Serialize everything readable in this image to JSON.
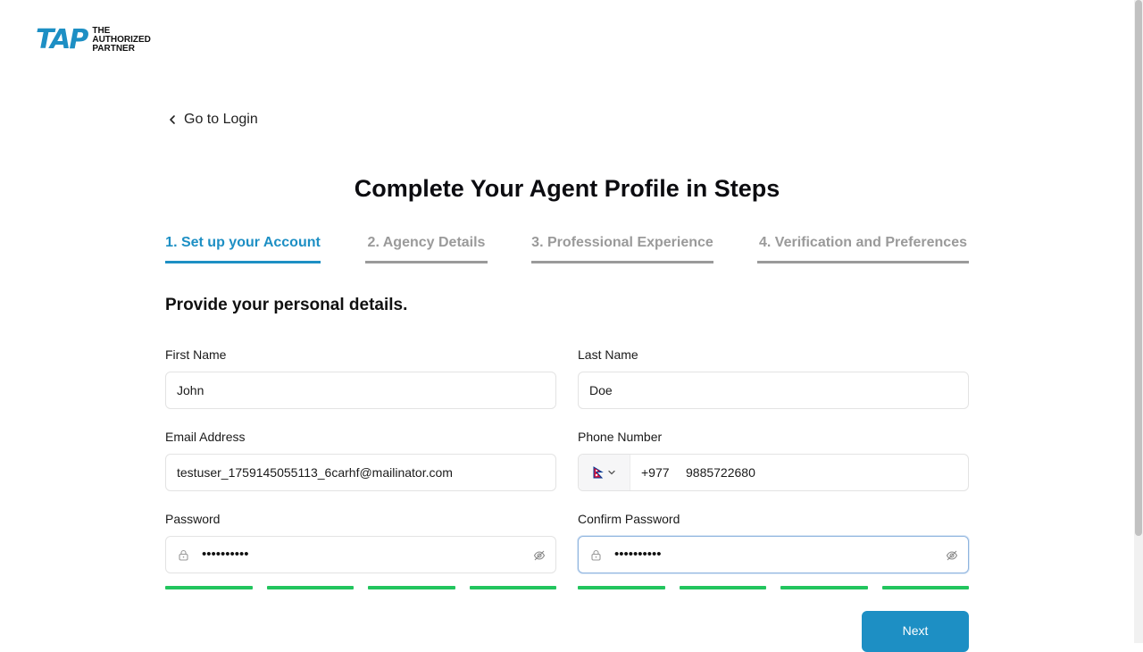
{
  "logo": {
    "mark": "TAP",
    "line1": "THE",
    "line2": "AUTHORIZED",
    "line3": "PARTNER"
  },
  "nav": {
    "back_label": "Go to Login"
  },
  "page_title": "Complete Your Agent Profile in Steps",
  "steps": [
    {
      "label": "1. Set up your Account",
      "active": true
    },
    {
      "label": "2. Agency Details",
      "active": false
    },
    {
      "label": "3. Professional Experience",
      "active": false
    },
    {
      "label": "4. Verification and Preferences",
      "active": false
    }
  ],
  "form": {
    "section_title": "Provide your personal details.",
    "first_name": {
      "label": "First Name",
      "value": "John"
    },
    "last_name": {
      "label": "Last Name",
      "value": "Doe"
    },
    "email": {
      "label": "Email Address",
      "value": "testuser_1759145055113_6carhf@mailinator.com"
    },
    "phone": {
      "label": "Phone Number",
      "country_flag": "nepal-flag-icon",
      "dial_code": "+977",
      "value": "9885722680"
    },
    "password": {
      "label": "Password",
      "masked_value": "••••••••••",
      "strength_segments_filled": 4,
      "strength_segments_total": 4
    },
    "confirm_password": {
      "label": "Confirm Password",
      "masked_value": "••••••••••",
      "strength_segments_filled": 4,
      "strength_segments_total": 4
    }
  },
  "actions": {
    "next_label": "Next"
  },
  "colors": {
    "accent": "#1d8fc4",
    "inactive_step": "#9a9a9a",
    "strength_good": "#22c55e",
    "flag_red": "#dc143c",
    "flag_blue": "#003893"
  }
}
